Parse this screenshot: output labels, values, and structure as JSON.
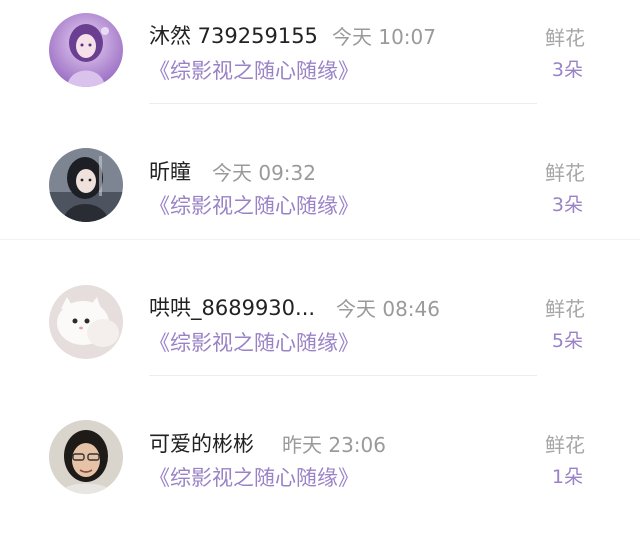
{
  "messages": [
    {
      "name": "沐然 739259155",
      "time": "今天 10:07",
      "work": "《综影视之随心随缘》",
      "gift_label": "鲜花",
      "gift_count": "3朵",
      "avatar": "anime-girl-purple-avatar"
    },
    {
      "name": "昕瞳",
      "time": "今天 09:32",
      "work": "《综影视之随心随缘》",
      "gift_label": "鲜花",
      "gift_count": "3朵",
      "avatar": "anime-girl-dark-hair-avatar"
    },
    {
      "name": "哄哄_8689930...",
      "time": "今天 08:46",
      "work": "《综影视之随心随缘》",
      "gift_label": "鲜花",
      "gift_count": "5朵",
      "avatar": "white-cat-avatar"
    },
    {
      "name": "可爱的彬彬",
      "time": "昨天 23:06",
      "work": "《综影视之随心随缘》",
      "gift_label": "鲜花",
      "gift_count": "1朵",
      "avatar": "woman-photo-avatar"
    }
  ],
  "colors": {
    "accent_purple": "#9a82c7",
    "name_text": "#222222",
    "meta_text": "#9a9a9a"
  }
}
